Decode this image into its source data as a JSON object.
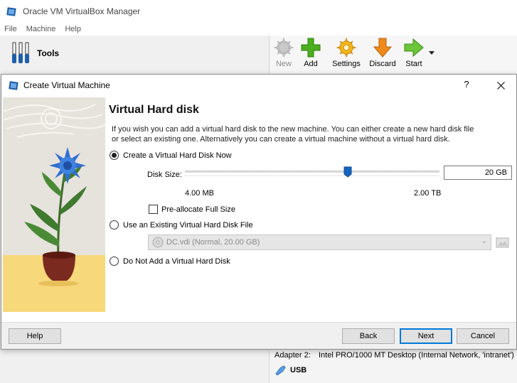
{
  "manager": {
    "title": "Oracle VM VirtualBox Manager",
    "menu": [
      "File",
      "Machine",
      "Help"
    ],
    "tools_label": "Tools",
    "toolbar": {
      "new": "New",
      "add": "Add",
      "settings": "Settings",
      "discard": "Discard",
      "start": "Start"
    },
    "details": {
      "adapter_key": "Adapter 2:",
      "adapter_value": "Intel PRO/1000 MT Desktop (Internal Network, 'intranet')",
      "usb_label": "USB"
    }
  },
  "dialog": {
    "title": "Create Virtual Machine",
    "help_glyph": "?",
    "heading": "Virtual Hard disk",
    "description": "If you wish you can add a virtual hard disk to the new machine. You can either create a new hard disk file or select an existing one. Alternatively you can create a virtual machine without a virtual hard disk.",
    "options": {
      "create_now": "Create a Virtual Hard Disk Now",
      "use_existing": "Use an Existing Virtual Hard Disk File",
      "do_not_add": "Do Not Add a Virtual Hard Disk"
    },
    "selected_option": "create_now",
    "disk_size_label": "Disk Size:",
    "disk_size_value": "20 GB",
    "slider_min_label": "4.00 MB",
    "slider_max_label": "2.00 TB",
    "slider_position": 0.64,
    "preallocate_label": "Pre-allocate Full Size",
    "preallocate_checked": false,
    "existing_disk_value": "DC.vdi (Normal, 20.00 GB)",
    "buttons": {
      "help": "Help",
      "back": "Back",
      "next": "Next",
      "cancel": "Cancel"
    }
  },
  "colors": {
    "accent": "#0078d7",
    "add_green": "#4caf1e",
    "discard_orange": "#f08a1c",
    "settings_yellow": "#f2b51b",
    "flower_blue": "#2f6fd0",
    "floor_yellow": "#f7d87a"
  }
}
